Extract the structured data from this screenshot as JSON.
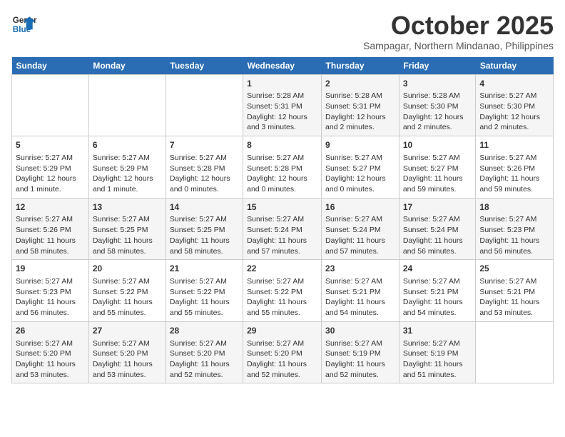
{
  "header": {
    "logo_line1": "General",
    "logo_line2": "Blue",
    "month": "October 2025",
    "location": "Sampagar, Northern Mindanao, Philippines"
  },
  "days_of_week": [
    "Sunday",
    "Monday",
    "Tuesday",
    "Wednesday",
    "Thursday",
    "Friday",
    "Saturday"
  ],
  "weeks": [
    [
      {
        "day": "",
        "info": ""
      },
      {
        "day": "",
        "info": ""
      },
      {
        "day": "",
        "info": ""
      },
      {
        "day": "1",
        "info": "Sunrise: 5:28 AM\nSunset: 5:31 PM\nDaylight: 12 hours and 3 minutes."
      },
      {
        "day": "2",
        "info": "Sunrise: 5:28 AM\nSunset: 5:31 PM\nDaylight: 12 hours and 2 minutes."
      },
      {
        "day": "3",
        "info": "Sunrise: 5:28 AM\nSunset: 5:30 PM\nDaylight: 12 hours and 2 minutes."
      },
      {
        "day": "4",
        "info": "Sunrise: 5:27 AM\nSunset: 5:30 PM\nDaylight: 12 hours and 2 minutes."
      }
    ],
    [
      {
        "day": "5",
        "info": "Sunrise: 5:27 AM\nSunset: 5:29 PM\nDaylight: 12 hours and 1 minute."
      },
      {
        "day": "6",
        "info": "Sunrise: 5:27 AM\nSunset: 5:29 PM\nDaylight: 12 hours and 1 minute."
      },
      {
        "day": "7",
        "info": "Sunrise: 5:27 AM\nSunset: 5:28 PM\nDaylight: 12 hours and 0 minutes."
      },
      {
        "day": "8",
        "info": "Sunrise: 5:27 AM\nSunset: 5:28 PM\nDaylight: 12 hours and 0 minutes."
      },
      {
        "day": "9",
        "info": "Sunrise: 5:27 AM\nSunset: 5:27 PM\nDaylight: 12 hours and 0 minutes."
      },
      {
        "day": "10",
        "info": "Sunrise: 5:27 AM\nSunset: 5:27 PM\nDaylight: 11 hours and 59 minutes."
      },
      {
        "day": "11",
        "info": "Sunrise: 5:27 AM\nSunset: 5:26 PM\nDaylight: 11 hours and 59 minutes."
      }
    ],
    [
      {
        "day": "12",
        "info": "Sunrise: 5:27 AM\nSunset: 5:26 PM\nDaylight: 11 hours and 58 minutes."
      },
      {
        "day": "13",
        "info": "Sunrise: 5:27 AM\nSunset: 5:25 PM\nDaylight: 11 hours and 58 minutes."
      },
      {
        "day": "14",
        "info": "Sunrise: 5:27 AM\nSunset: 5:25 PM\nDaylight: 11 hours and 58 minutes."
      },
      {
        "day": "15",
        "info": "Sunrise: 5:27 AM\nSunset: 5:24 PM\nDaylight: 11 hours and 57 minutes."
      },
      {
        "day": "16",
        "info": "Sunrise: 5:27 AM\nSunset: 5:24 PM\nDaylight: 11 hours and 57 minutes."
      },
      {
        "day": "17",
        "info": "Sunrise: 5:27 AM\nSunset: 5:24 PM\nDaylight: 11 hours and 56 minutes."
      },
      {
        "day": "18",
        "info": "Sunrise: 5:27 AM\nSunset: 5:23 PM\nDaylight: 11 hours and 56 minutes."
      }
    ],
    [
      {
        "day": "19",
        "info": "Sunrise: 5:27 AM\nSunset: 5:23 PM\nDaylight: 11 hours and 56 minutes."
      },
      {
        "day": "20",
        "info": "Sunrise: 5:27 AM\nSunset: 5:22 PM\nDaylight: 11 hours and 55 minutes."
      },
      {
        "day": "21",
        "info": "Sunrise: 5:27 AM\nSunset: 5:22 PM\nDaylight: 11 hours and 55 minutes."
      },
      {
        "day": "22",
        "info": "Sunrise: 5:27 AM\nSunset: 5:22 PM\nDaylight: 11 hours and 55 minutes."
      },
      {
        "day": "23",
        "info": "Sunrise: 5:27 AM\nSunset: 5:21 PM\nDaylight: 11 hours and 54 minutes."
      },
      {
        "day": "24",
        "info": "Sunrise: 5:27 AM\nSunset: 5:21 PM\nDaylight: 11 hours and 54 minutes."
      },
      {
        "day": "25",
        "info": "Sunrise: 5:27 AM\nSunset: 5:21 PM\nDaylight: 11 hours and 53 minutes."
      }
    ],
    [
      {
        "day": "26",
        "info": "Sunrise: 5:27 AM\nSunset: 5:20 PM\nDaylight: 11 hours and 53 minutes."
      },
      {
        "day": "27",
        "info": "Sunrise: 5:27 AM\nSunset: 5:20 PM\nDaylight: 11 hours and 53 minutes."
      },
      {
        "day": "28",
        "info": "Sunrise: 5:27 AM\nSunset: 5:20 PM\nDaylight: 11 hours and 52 minutes."
      },
      {
        "day": "29",
        "info": "Sunrise: 5:27 AM\nSunset: 5:20 PM\nDaylight: 11 hours and 52 minutes."
      },
      {
        "day": "30",
        "info": "Sunrise: 5:27 AM\nSunset: 5:19 PM\nDaylight: 11 hours and 52 minutes."
      },
      {
        "day": "31",
        "info": "Sunrise: 5:27 AM\nSunset: 5:19 PM\nDaylight: 11 hours and 51 minutes."
      },
      {
        "day": "",
        "info": ""
      }
    ]
  ]
}
